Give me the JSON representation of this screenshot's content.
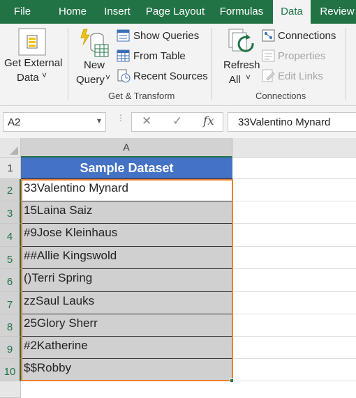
{
  "tabs": [
    {
      "label": "File",
      "active": false
    },
    {
      "label": "Home",
      "active": false
    },
    {
      "label": "Insert",
      "active": false
    },
    {
      "label": "Page Layout",
      "active": false
    },
    {
      "label": "Formulas",
      "active": false
    },
    {
      "label": "Data",
      "active": true
    },
    {
      "label": "Review",
      "active": false
    }
  ],
  "ribbon": {
    "get_external": {
      "line1": "Get External",
      "line2": "Data",
      "chev": "˅"
    },
    "new_query": {
      "line1": "New",
      "line2": "Query",
      "chev": "˅"
    },
    "show_queries": "Show Queries",
    "from_table": "From Table",
    "recent_sources": "Recent Sources",
    "get_transform_label": "Get & Transform",
    "refresh_all": {
      "line1": "Refresh",
      "line2": "All",
      "chev": "˅"
    },
    "connections": "Connections",
    "properties": "Properties",
    "edit_links": "Edit Links",
    "connections_label": "Connections"
  },
  "formula_bar": {
    "name_box": "A2",
    "name_box_dropdown": "▾",
    "cancel": "✕",
    "enter": "✓",
    "fx": "fx",
    "value": "33Valentino Mynard"
  },
  "sheet": {
    "column_header": "A",
    "header_row": {
      "row": "1",
      "text": "Sample Dataset"
    },
    "rows": [
      {
        "row": "2",
        "value": "33Valentino Mynard"
      },
      {
        "row": "3",
        "value": "15Laina Saiz"
      },
      {
        "row": "4",
        "value": "#9Jose Kleinhaus"
      },
      {
        "row": "5",
        "value": "##Allie Kingswold"
      },
      {
        "row": "6",
        "value": "()Terri Spring"
      },
      {
        "row": "7",
        "value": "zzSaul Lauks"
      },
      {
        "row": "8",
        "value": "25Glory Sherr"
      },
      {
        "row": "9",
        "value": "#2Katherine"
      },
      {
        "row": "10",
        "value": "$$Robby"
      }
    ]
  },
  "colors": {
    "ribbon_tab_bar": "#217346",
    "header_fill": "#4472c4",
    "selection_border": "#ed7d31",
    "data_fill": "#d0d0d0"
  }
}
